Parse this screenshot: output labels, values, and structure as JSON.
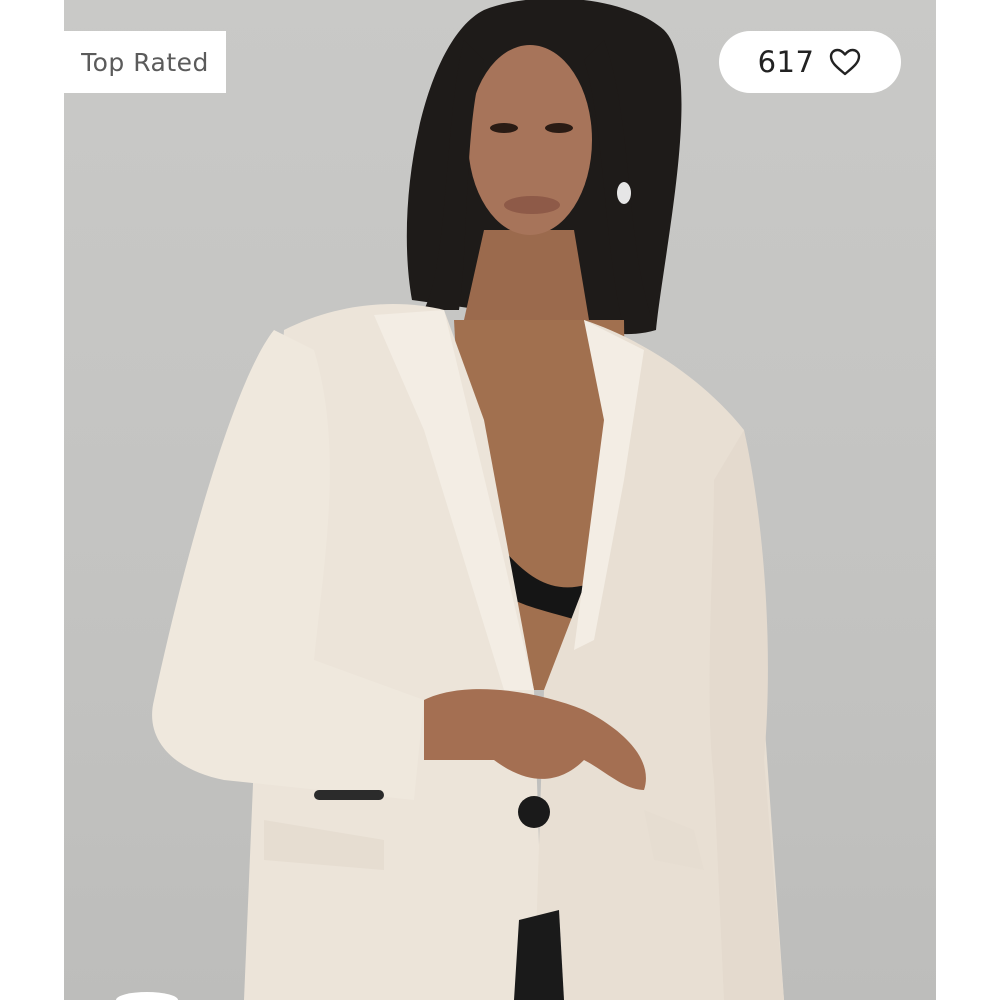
{
  "badge": {
    "label": "Top Rated"
  },
  "favorite": {
    "count": "617",
    "icon": "heart-outline-icon"
  },
  "image": {
    "description_icon": "product-photo"
  },
  "colors": {
    "background": "#c6c6c4",
    "badge_bg": "#ffffff",
    "badge_text": "#5b5b5b",
    "count_text": "#222222"
  }
}
